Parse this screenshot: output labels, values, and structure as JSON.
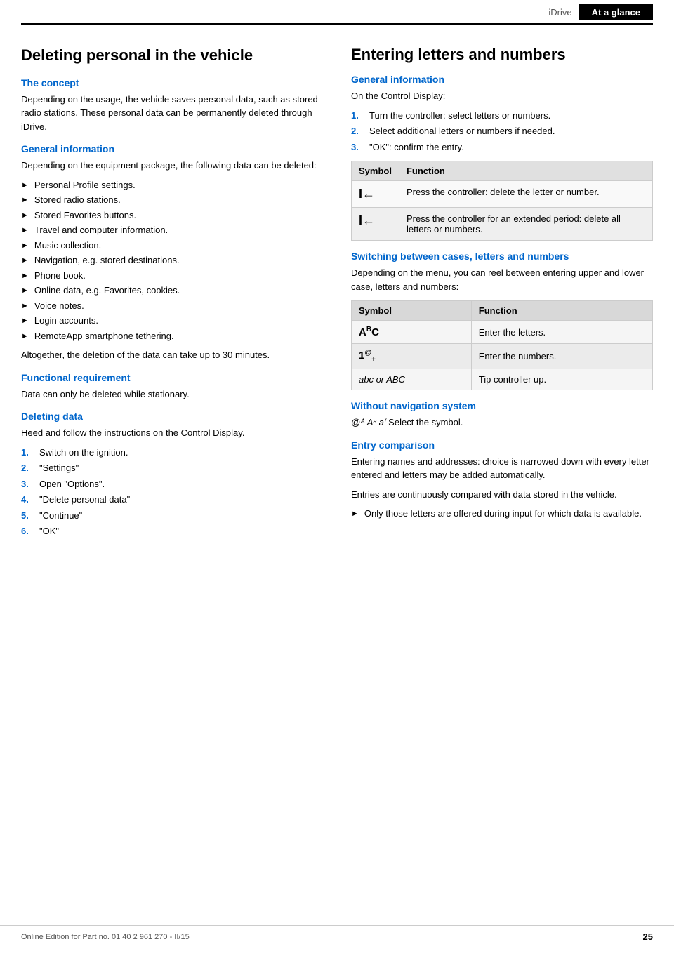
{
  "header": {
    "idrive_label": "iDrive",
    "tab_label": "At a glance"
  },
  "left": {
    "main_title": "Deleting personal in the vehicle",
    "concept_heading": "The concept",
    "concept_text": "Depending on the usage, the vehicle saves personal data, such as stored radio stations. These personal data can be permanently deleted through iDrive.",
    "general_info_heading": "General information",
    "general_info_text": "Depending on the equipment package, the following data can be deleted:",
    "bullet_items": [
      "Personal Profile settings.",
      "Stored radio stations.",
      "Stored Favorites buttons.",
      "Travel and computer information.",
      "Music collection.",
      "Navigation, e.g. stored destinations.",
      "Phone book.",
      "Online data, e.g. Favorites, cookies.",
      "Voice notes.",
      "Login accounts.",
      "RemoteApp smartphone tethering."
    ],
    "general_info_footer": "Altogether, the deletion of the data can take up to 30 minutes.",
    "functional_req_heading": "Functional requirement",
    "functional_req_text": "Data can only be deleted while stationary.",
    "deleting_data_heading": "Deleting data",
    "deleting_data_text": "Heed and follow the instructions on the Control Display.",
    "steps": [
      {
        "num": "1.",
        "text": "Switch on the ignition."
      },
      {
        "num": "2.",
        "text": "\"Settings\""
      },
      {
        "num": "3.",
        "text": "Open \"Options\"."
      },
      {
        "num": "4.",
        "text": "\"Delete personal data\""
      },
      {
        "num": "5.",
        "text": "\"Continue\""
      },
      {
        "num": "6.",
        "text": "\"OK\""
      }
    ]
  },
  "right": {
    "main_title": "Entering letters and numbers",
    "general_info_heading": "General information",
    "general_info_text": "On the Control Display:",
    "steps": [
      {
        "num": "1.",
        "text": "Turn the controller: select letters or numbers."
      },
      {
        "num": "2.",
        "text": "Select additional letters or numbers if needed."
      },
      {
        "num": "3.",
        "text": "\"OK\": confirm the entry."
      }
    ],
    "symbol_table": {
      "col1": "Symbol",
      "col2": "Function",
      "rows": [
        {
          "symbol": "I←",
          "function": "Press the controller: delete the letter or number."
        },
        {
          "symbol": "I←",
          "function": "Press the controller for an extended period: delete all letters or numbers."
        }
      ]
    },
    "switching_heading": "Switching between cases, letters and numbers",
    "switching_text": "Depending on the menu, you can reel between entering upper and lower case, letters and numbers:",
    "switch_table": {
      "col1": "Symbol",
      "col2": "Function",
      "rows": [
        {
          "symbol": "AᴬC",
          "function": "Enter the letters."
        },
        {
          "symbol": "1@+",
          "function": "Enter the numbers."
        },
        {
          "symbol": "abc or ABC",
          "function": "Tip controller up."
        }
      ]
    },
    "without_nav_heading": "Without navigation system",
    "without_nav_symbols": "@ᴬ  Aᵃ  aᶠ",
    "without_nav_text": "Select the symbol.",
    "entry_comparison_heading": "Entry comparison",
    "entry_comparison_text1": "Entering names and addresses: choice is narrowed down with every letter entered and letters may be added automatically.",
    "entry_comparison_text2": "Entries are continuously compared with data stored in the vehicle.",
    "entry_comparison_bullet": "Only those letters are offered during input for which data is available."
  },
  "footer": {
    "text": "Online Edition for Part no. 01 40 2 961 270 - II/15",
    "page": "25"
  }
}
